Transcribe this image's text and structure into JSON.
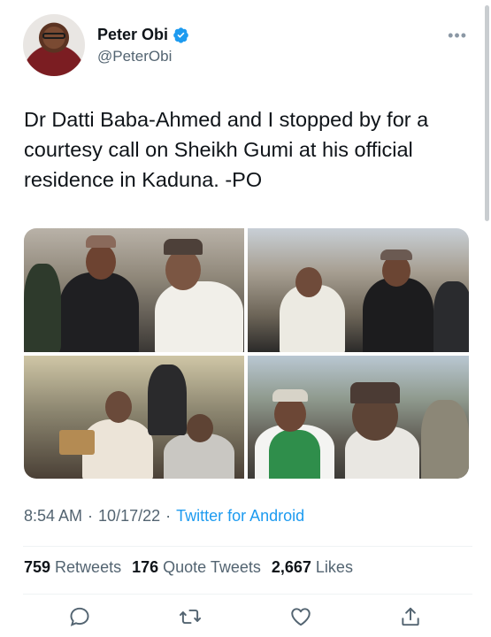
{
  "author": {
    "name": "Peter Obi",
    "handle": "@PeterObi",
    "verified": true
  },
  "tweet": {
    "text": "Dr Datti Baba-Ahmed and I stopped by for a courtesy call on Sheikh Gumi at his official residence in Kaduna. -PO"
  },
  "meta": {
    "time": "8:54 AM",
    "separator": "·",
    "date": "10/17/22",
    "source": "Twitter for Android"
  },
  "stats": {
    "retweets_count": "759",
    "retweets_label": "Retweets",
    "quote_count": "176",
    "quote_label": "Quote Tweets",
    "likes_count": "2,667",
    "likes_label": "Likes"
  },
  "colors": {
    "accent": "#1d9bf0",
    "secondary_text": "#536471",
    "primary_text": "#0f1419"
  },
  "icons": [
    "verified-badge-icon",
    "more-options-icon",
    "reply-icon",
    "retweet-icon",
    "like-icon",
    "share-icon"
  ]
}
